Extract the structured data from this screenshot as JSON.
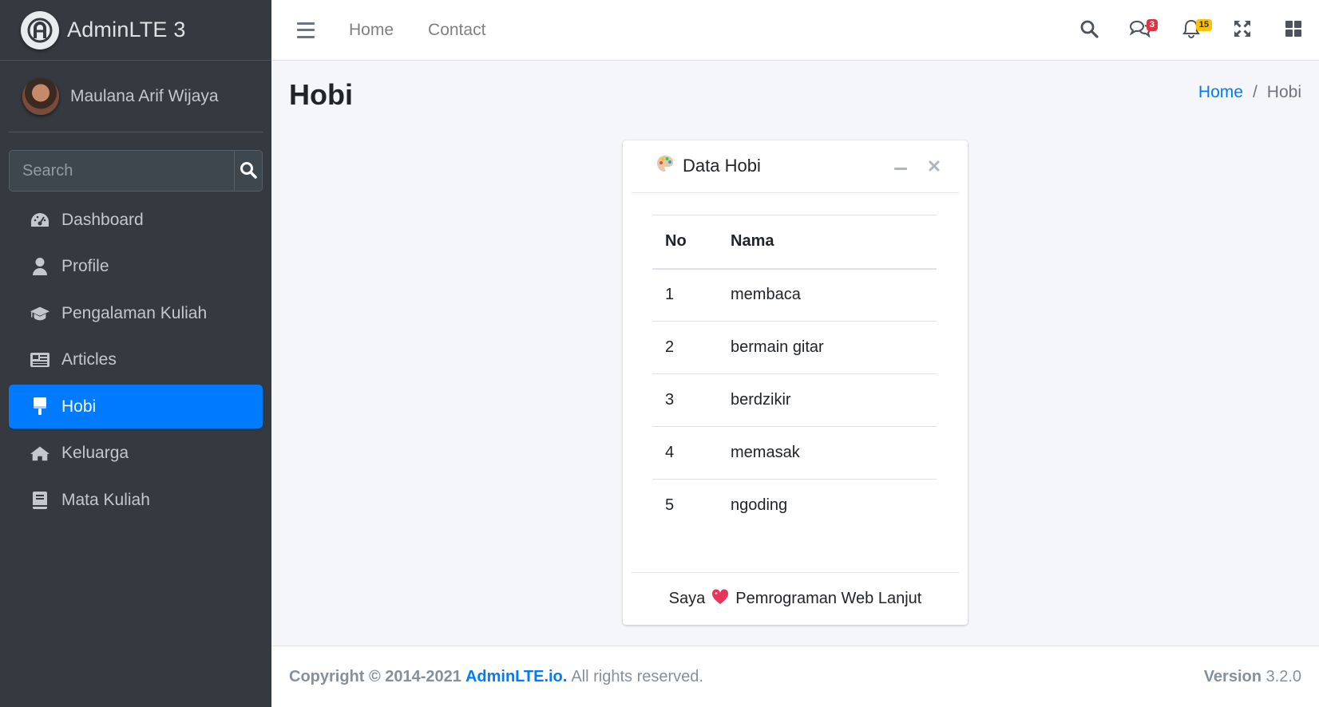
{
  "brand": {
    "name": "AdminLTE 3",
    "logo_icon": "adminlte-logo-icon"
  },
  "user": {
    "name": "Maulana Arif Wijaya"
  },
  "sidebar_search": {
    "placeholder": "Search",
    "icon": "search-icon"
  },
  "sidebar": {
    "items": [
      {
        "label": "Dashboard",
        "icon": "tachometer-icon",
        "active": false
      },
      {
        "label": "Profile",
        "icon": "user-icon",
        "active": false
      },
      {
        "label": "Pengalaman Kuliah",
        "icon": "graduation-cap-icon",
        "active": false
      },
      {
        "label": "Articles",
        "icon": "newspaper-icon",
        "active": false
      },
      {
        "label": "Hobi",
        "icon": "paint-brush-icon",
        "active": true
      },
      {
        "label": "Keluarga",
        "icon": "home-icon",
        "active": false
      },
      {
        "label": "Mata Kuliah",
        "icon": "book-icon",
        "active": false
      }
    ]
  },
  "navbar": {
    "links": [
      "Home",
      "Contact"
    ],
    "messages_badge": "3",
    "notifications_badge": "15",
    "accent_color": "#007bff",
    "danger_color": "#dc3545",
    "warning_color": "#ffc107"
  },
  "page": {
    "title": "Hobi",
    "breadcrumb": {
      "home": "Home",
      "separator": "/",
      "current": "Hobi"
    }
  },
  "card": {
    "title": "Data Hobi",
    "columns": [
      "No",
      "Nama"
    ],
    "rows": [
      [
        "1",
        "membaca"
      ],
      [
        "2",
        "bermain gitar"
      ],
      [
        "3",
        "berdzikir"
      ],
      [
        "4",
        "memasak"
      ],
      [
        "5",
        "ngoding"
      ]
    ],
    "footer": {
      "before": "Saya",
      "after": "Pemrograman Web Lanjut"
    }
  },
  "footer": {
    "copyright": "Copyright © 2014-2021",
    "brand_link": "AdminLTE.io.",
    "rights": "All rights reserved.",
    "version_label": "Version",
    "version": "3.2.0"
  }
}
